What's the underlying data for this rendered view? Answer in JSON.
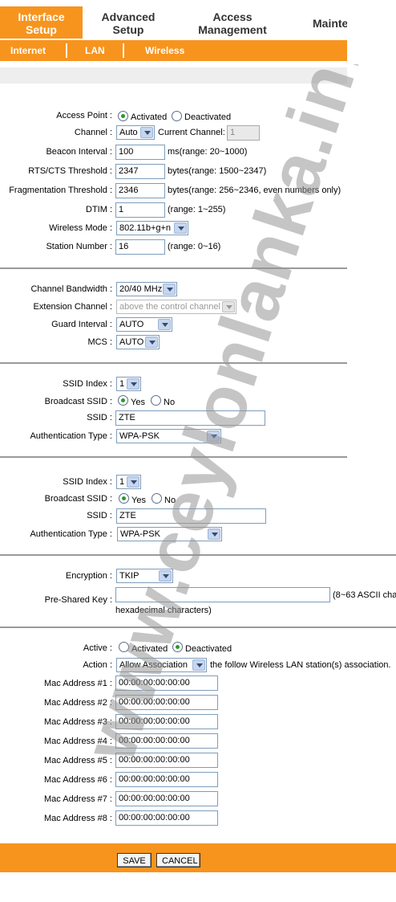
{
  "top_tabs": [
    {
      "label_line1": "Interface",
      "label_line2": "Setup",
      "active": true
    },
    {
      "label_line1": "Advanced",
      "label_line2": "Setup",
      "active": false
    },
    {
      "label_line1": "Access",
      "label_line2": "Management",
      "active": false
    },
    {
      "label_line1": "Mainte",
      "label_line2": "",
      "active": false
    }
  ],
  "sub_tabs": [
    "Internet",
    "LAN",
    "Wireless"
  ],
  "section1": {
    "access_point": {
      "label": "Access Point :",
      "opt_on": "Activated",
      "opt_off": "Deactivated",
      "selected": "Activated"
    },
    "channel": {
      "label": "Channel :",
      "value": "Auto",
      "current_label": "Current Channel:",
      "current_value": "1"
    },
    "beacon": {
      "label": "Beacon Interval :",
      "value": "100",
      "hint": "ms(range: 20~1000)"
    },
    "rts": {
      "label": "RTS/CTS Threshold :",
      "value": "2347",
      "hint": "bytes(range: 1500~2347)"
    },
    "frag": {
      "label": "Fragmentation Threshold :",
      "value": "2346",
      "hint": "bytes(range: 256~2346, even numbers only)"
    },
    "dtim": {
      "label": "DTIM :",
      "value": "1",
      "hint": "(range: 1~255)"
    },
    "mode": {
      "label": "Wireless Mode :",
      "value": "802.11b+g+n"
    },
    "station": {
      "label": "Station Number :",
      "value": "16",
      "hint": "(range: 0~16)"
    }
  },
  "section2": {
    "bandwidth": {
      "label": "Channel Bandwidth :",
      "value": "20/40 MHz"
    },
    "extension": {
      "label": "Extension Channel :",
      "value": "above the control channel"
    },
    "guard": {
      "label": "Guard Interval :",
      "value": "AUTO"
    },
    "mcs": {
      "label": "MCS :",
      "value": "AUTO"
    }
  },
  "ssid_blocks": [
    {
      "index_label": "SSID Index :",
      "index_value": "1",
      "broadcast_label": "Broadcast SSID :",
      "yes": "Yes",
      "no": "No",
      "selected": "Yes",
      "ssid_label": "SSID :",
      "ssid_value": "ZTE",
      "auth_label": "Authentication Type :",
      "auth_value": "WPA-PSK"
    },
    {
      "index_label": "SSID Index :",
      "index_value": "1",
      "broadcast_label": "Broadcast SSID :",
      "yes": "Yes",
      "no": "No",
      "selected": "Yes",
      "ssid_label": "SSID :",
      "ssid_value": "ZTE",
      "auth_label": "Authentication Type :",
      "auth_value": "WPA-PSK"
    }
  ],
  "encryption": {
    "label": "Encryption :",
    "value": "TKIP",
    "psk_label": "Pre-Shared Key :",
    "psk_value": "",
    "psk_hint1": "(8~63 ASCII cha",
    "psk_hint2": "hexadecimal characters)"
  },
  "mac_filter": {
    "active_label": "Active :",
    "opt_on": "Activated",
    "opt_off": "Deactivated",
    "selected": "Deactivated",
    "action_label": "Action :",
    "action_value": "Allow Association",
    "action_hint": "the follow Wireless LAN station(s) association.",
    "addresses": [
      {
        "label": "Mac Address #1 :",
        "value": "00:00:00:00:00:00"
      },
      {
        "label": "Mac Address #2 :",
        "value": "00:00:00:00:00:00"
      },
      {
        "label": "Mac Address #3 :",
        "value": "00:00:00:00:00:00"
      },
      {
        "label": "Mac Address #4 :",
        "value": "00:00:00:00:00:00"
      },
      {
        "label": "Mac Address #5 :",
        "value": "00:00:00:00:00:00"
      },
      {
        "label": "Mac Address #6 :",
        "value": "00:00:00:00:00:00"
      },
      {
        "label": "Mac Address #7 :",
        "value": "00:00:00:00:00:00"
      },
      {
        "label": "Mac Address #8 :",
        "value": "00:00:00:00:00:00"
      }
    ]
  },
  "buttons": {
    "save": "SAVE",
    "cancel": "CANCEL"
  },
  "watermark": "www.ceylonlanka.info",
  "colors": {
    "accent": "#f7941d",
    "divider": "#9a9a9a"
  }
}
